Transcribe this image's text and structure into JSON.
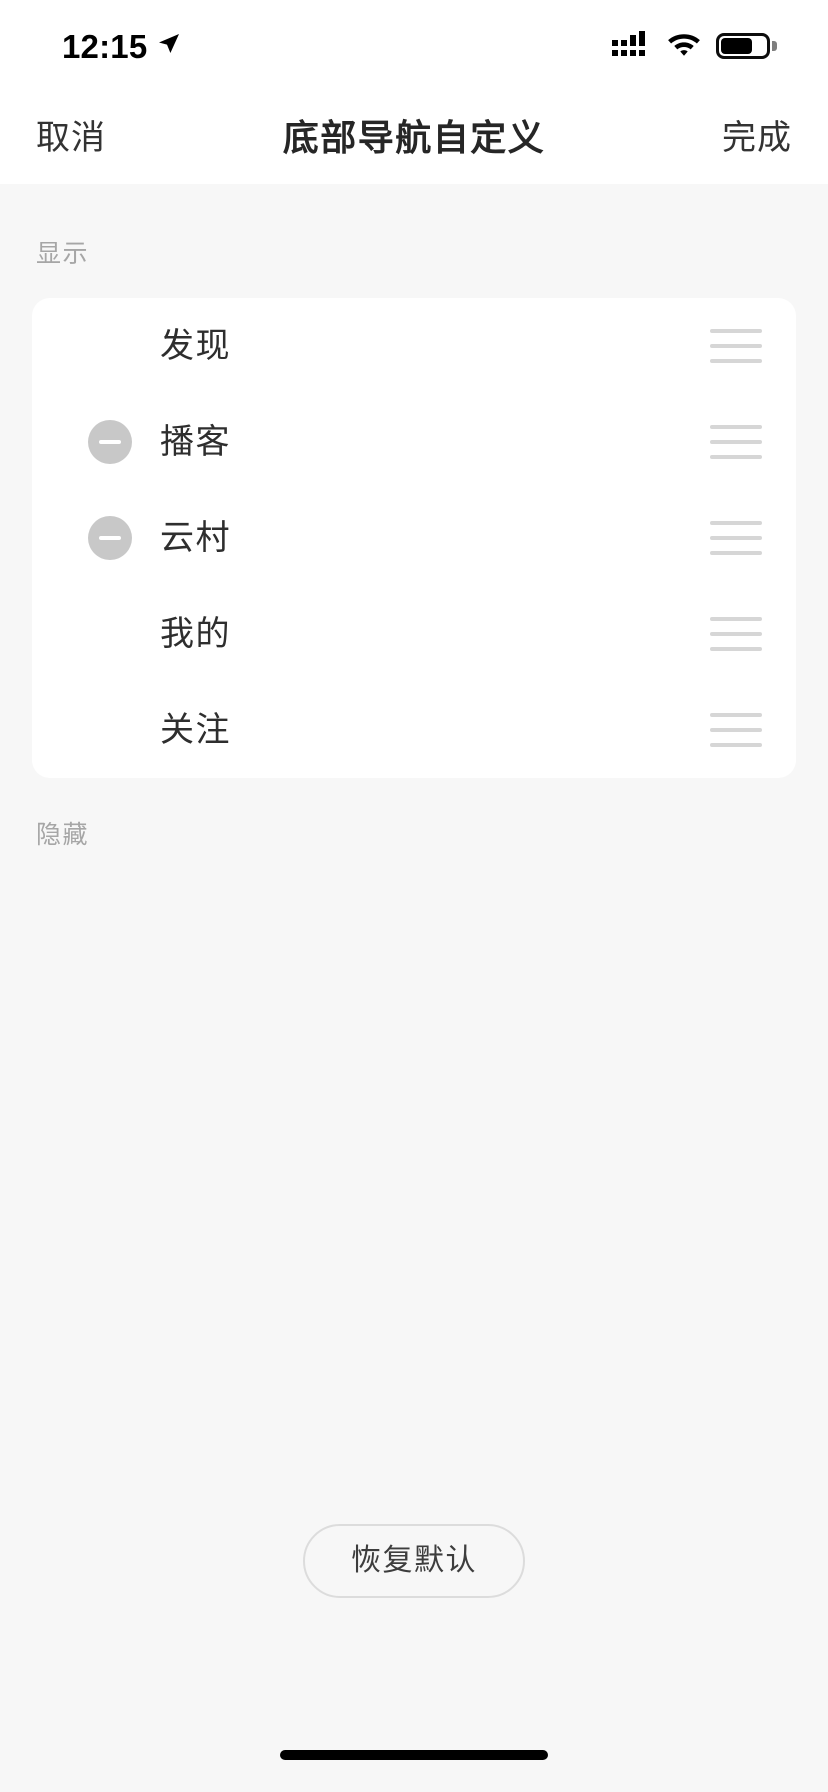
{
  "status_bar": {
    "time": "12:15",
    "location_icon": "location-arrow-icon",
    "signal_icon": "cellular-signal-icon",
    "wifi_icon": "wifi-icon",
    "battery_icon": "battery-icon",
    "battery_level_percent": 58
  },
  "header": {
    "cancel_label": "取消",
    "title": "底部导航自定义",
    "done_label": "完成"
  },
  "sections": {
    "shown_label": "显示",
    "hidden_label": "隐藏"
  },
  "shown_items": [
    {
      "label": "发现",
      "removable": false,
      "minus_icon": "",
      "drag_icon": "drag-handle-icon"
    },
    {
      "label": "播客",
      "removable": true,
      "minus_icon": "minus-circle-icon",
      "drag_icon": "drag-handle-icon"
    },
    {
      "label": "云村",
      "removable": true,
      "minus_icon": "minus-circle-icon",
      "drag_icon": "drag-handle-icon"
    },
    {
      "label": "我的",
      "removable": false,
      "minus_icon": "",
      "drag_icon": "drag-handle-icon"
    },
    {
      "label": "关注",
      "removable": false,
      "minus_icon": "",
      "drag_icon": "drag-handle-icon"
    }
  ],
  "hidden_items": [],
  "footer": {
    "restore_label": "恢复默认"
  },
  "colors": {
    "page_background": "#f7f7f7",
    "card_background": "#ffffff",
    "header_background": "#ffffff",
    "primary_text": "#2e2e2e",
    "secondary_text": "#a6a6a6",
    "nav_button_text": "#333333",
    "minus_circle": "#c8c8c8",
    "drag_handle_line": "#d6d6d6",
    "restore_border": "#dcdcdc",
    "home_indicator": "#000000"
  }
}
